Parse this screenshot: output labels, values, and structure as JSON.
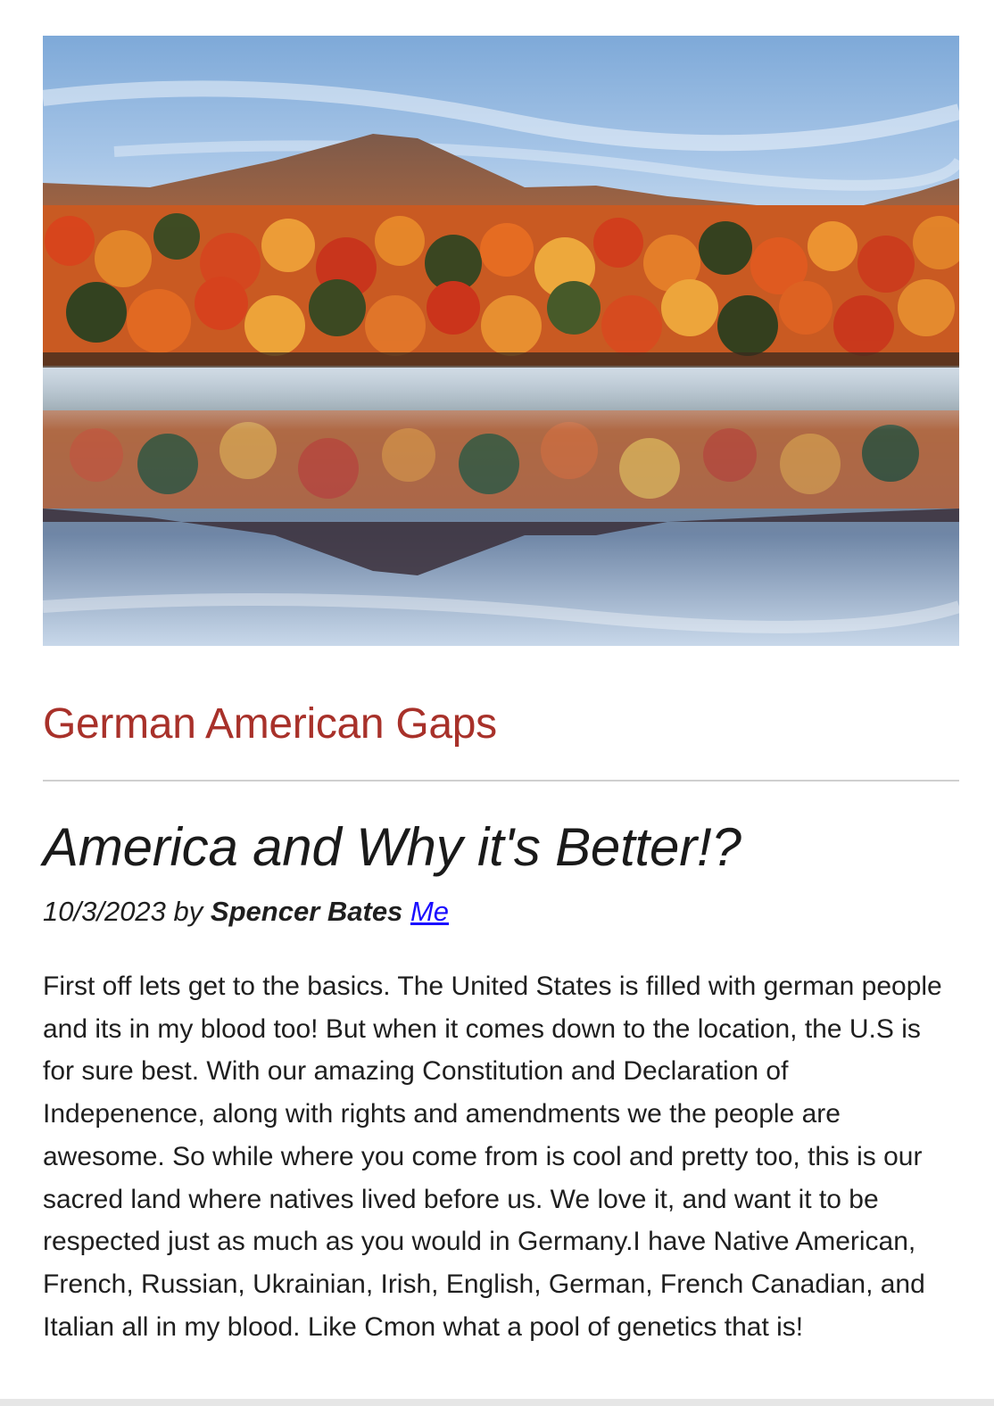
{
  "hero": {
    "image_alt": "Autumn forest and mountain reflected in a misty lake"
  },
  "site": {
    "title": "German American Gaps"
  },
  "post": {
    "title": "America and Why it's Better!?",
    "date": "10/3/2023",
    "by": "by",
    "author": "Spencer Bates",
    "author_link": "Me",
    "body": "First off lets get to the basics. The United States is filled with german people and its in my blood too! But when it comes down to the location, the U.S is for sure best. With our amazing Constitution and Declaration of Indepenence, along with rights and amendments we the people are awesome. So while where you come from is cool and pretty too, this is our sacred land where natives lived before us. We love it, and want it to be respected just as much as you would in Germany.I have Native American, French, Russian, Ukrainian, Irish, English, German, French Canadian, and Italian all in my blood. Like Cmon what a pool of genetics that is!"
  },
  "colors": {
    "site_title": "#a8312a",
    "link": "#1a0dff",
    "text": "#1f1f1f",
    "rule": "#cfcfcf"
  }
}
